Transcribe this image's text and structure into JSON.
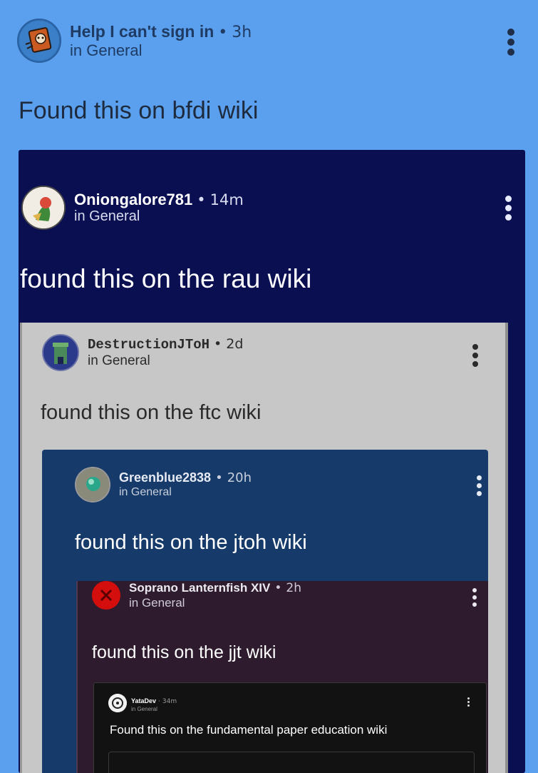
{
  "colors": {
    "page_bg": "#5aa0ee",
    "level1_bg": "#0a0f52",
    "level2_bg": "#c7c7c7",
    "level3_bg": "#163a6a",
    "level4_bg": "#2e1c2e",
    "level5_bg": "#121212"
  },
  "post": {
    "author": "Help I can't sign in",
    "separator": "•",
    "time": "3h",
    "category": "in General",
    "title": "Found this on bfdi wiki",
    "menu_icon": "kebab-icon",
    "embed": {
      "author": "Oniongalore781",
      "separator": "•",
      "time": "14m",
      "category": "in General",
      "title": "found this on the rau wiki",
      "embed": {
        "author": "DestructionJToH",
        "separator": "•",
        "time": "2d",
        "category": "in General",
        "title": "found this on the ftc wiki",
        "embed": {
          "author": "Greenblue2838",
          "separator": "•",
          "time": "20h",
          "category": "in General",
          "title": "found this on the jtoh wiki",
          "embed": {
            "author": "Soprano Lanternfish XIV",
            "separator": "•",
            "time": "2h",
            "category": "in General",
            "title": "found this on the jjt wiki",
            "embed": {
              "author": "YataDev",
              "separator": "·",
              "time": "34m",
              "category": "in General",
              "title": "Found this on the fundamental paper education wiki"
            }
          }
        }
      }
    }
  }
}
